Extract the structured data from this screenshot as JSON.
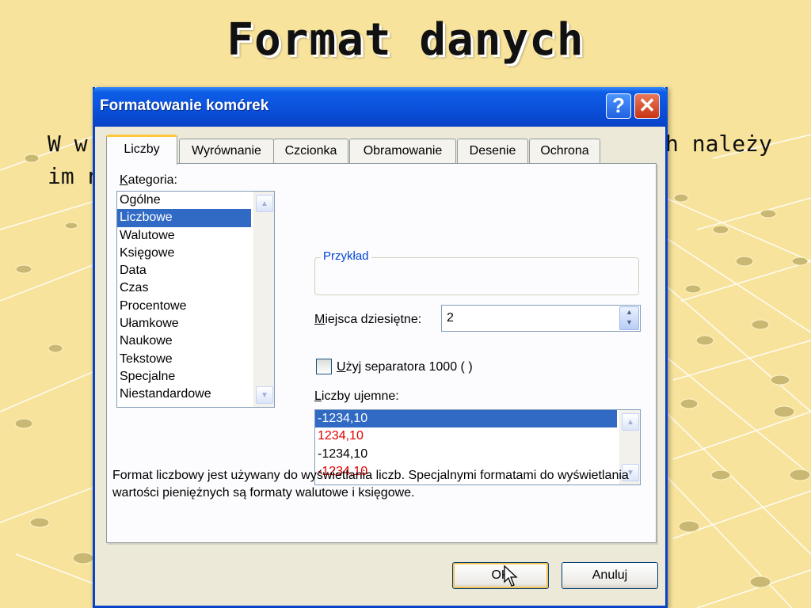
{
  "slide": {
    "title": "Format danych",
    "text_line1_left": "W w",
    "text_line1_right": "h należy",
    "text_line2_left": "im n"
  },
  "dialog": {
    "title": "Formatowanie komórek",
    "help_icon": "question-mark-icon",
    "close_icon": "close-x-icon",
    "tabs": [
      "Liczby",
      "Wyrównanie",
      "Czcionka",
      "Obramowanie",
      "Desenie",
      "Ochrona"
    ],
    "active_tab": "Liczby",
    "category_label_underlined": "K",
    "category_label_rest": "ategoria:",
    "categories": [
      "Ogólne",
      "Liczbowe",
      "Walutowe",
      "Księgowe",
      "Data",
      "Czas",
      "Procentowe",
      "Ułamkowe",
      "Naukowe",
      "Tekstowe",
      "Specjalne",
      "Niestandardowe"
    ],
    "selected_category": "Liczbowe",
    "sample_label": "Przykład",
    "decimal_label_underlined": "M",
    "decimal_label_rest": "iejsca dziesiętne:",
    "decimal_value": "2",
    "separator_label_underlined": "U",
    "separator_label_rest": "żyj separatora 1000 ( )",
    "separator_checked": false,
    "negative_label_underlined": "L",
    "negative_label_rest": "iczby ujemne:",
    "negative_formats": [
      {
        "text": "-1234,10",
        "color": "#000000",
        "selected": true
      },
      {
        "text": "1234,10",
        "color": "#e00000",
        "selected": false
      },
      {
        "text": "-1234,10",
        "color": "#000000",
        "selected": false
      },
      {
        "text": "-1234,10",
        "color": "#e00000",
        "selected": false
      }
    ],
    "description": "Format liczbowy jest używany do wyświetlania liczb. Specjalnymi formatami do wyświetlania wartości pieniężnych są formaty walutowe i księgowe.",
    "ok_label": "OK",
    "cancel_label": "Anuluj"
  },
  "colors": {
    "slide_background": "#f8e39c",
    "titlebar": "#0a4fd8",
    "selection": "#316ac5",
    "negative_red": "#e00000"
  }
}
